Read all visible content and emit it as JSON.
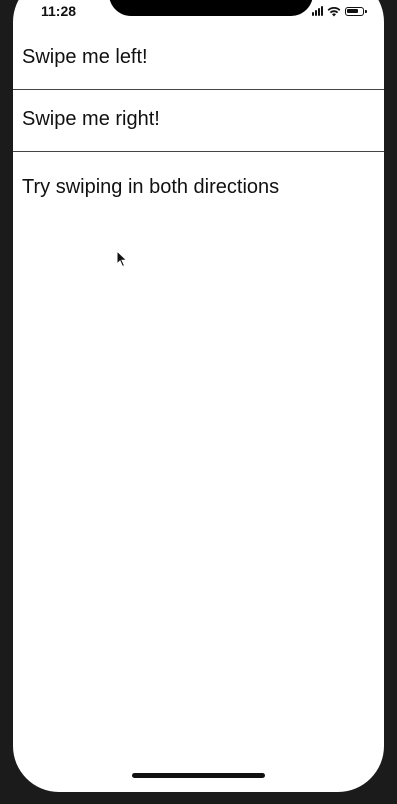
{
  "status_bar": {
    "time": "11:28"
  },
  "list": {
    "items": [
      {
        "label": "Swipe me left!"
      },
      {
        "label": "Swipe me right!"
      }
    ]
  },
  "hint": "Try swiping in both directions",
  "colors": {
    "frame": "#1b1b1b",
    "screen": "#ffffff",
    "text": "#111111",
    "divider": "#444444"
  }
}
